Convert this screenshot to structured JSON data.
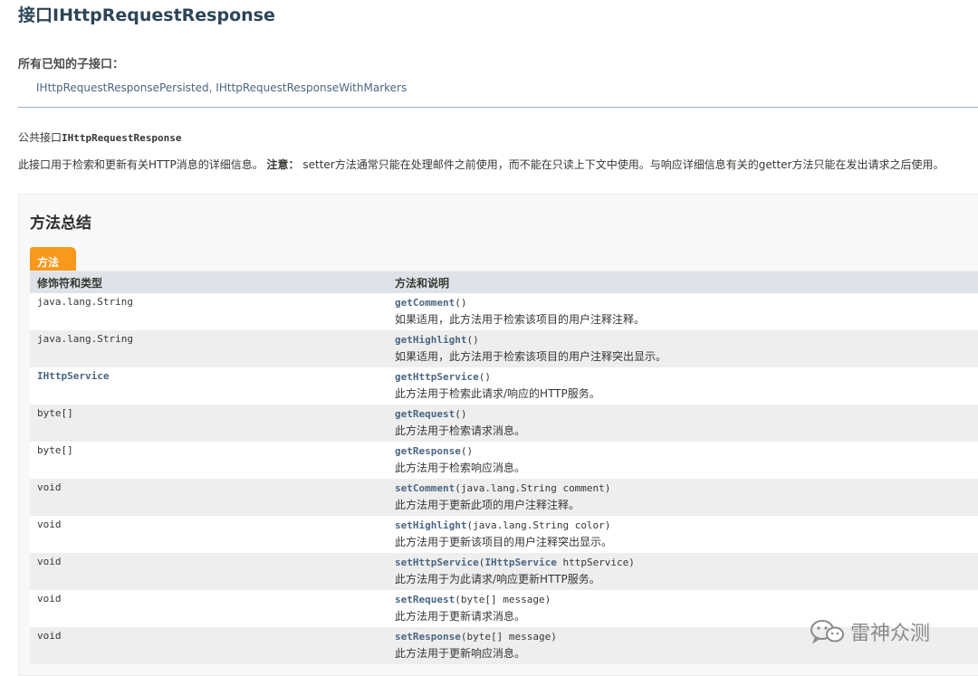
{
  "page": {
    "title": "接口IHttpRequestResponse",
    "known_subinterfaces_heading": "所有已知的子接口：",
    "subinterfaces": [
      "IHttpRequestResponsePersisted",
      "IHttpRequestResponseWithMarkers"
    ],
    "subinterface_separator": ", ",
    "declaration_prefix": "公共接口",
    "declaration_name": "IHttpRequestResponse",
    "description_main": "此接口用于检索和更新有关HTTP消息的详细信息。",
    "description_note_label": "注意：",
    "description_note": " setter方法通常只能在处理邮件之前使用，而不能在只读上下文中使用。与响应详细信息有关的getter方法只能在发出请求之后使用。"
  },
  "summary": {
    "heading": "方法总结",
    "tab_label": "方法",
    "col_type": "修饰符和类型",
    "col_method": "方法和说明",
    "rows": [
      {
        "type": "java.lang.String",
        "type_link": false,
        "method": "getComment",
        "params": "()",
        "desc": "如果适用，此方法用于检索该项目的用户注释注释。"
      },
      {
        "type": "java.lang.String",
        "type_link": false,
        "method": "getHighlight",
        "params": "()",
        "desc": "如果适用，此方法用于检索该项目的用户注释突出显示。"
      },
      {
        "type": "IHttpService",
        "type_link": true,
        "method": "getHttpService",
        "params": "()",
        "desc": "此方法用于检索此请求/响应的HTTP服务。"
      },
      {
        "type": "byte[]",
        "type_link": false,
        "method": "getRequest",
        "params": "()",
        "desc": "此方法用于检索请求消息。"
      },
      {
        "type": "byte[]",
        "type_link": false,
        "method": "getResponse",
        "params": "()",
        "desc": "此方法用于检索响应消息。"
      },
      {
        "type": "void",
        "type_link": false,
        "method": "setComment",
        "params": "(java.lang.String comment)",
        "desc": "此方法用于更新此项的用户注释注释。"
      },
      {
        "type": "void",
        "type_link": false,
        "method": "setHighlight",
        "params": "(java.lang.String color)",
        "desc": "此方法用于更新该项目的用户注释突出显示。"
      },
      {
        "type": "void",
        "type_link": false,
        "method": "setHttpService",
        "params_pre": "(",
        "params_link": "IHttpService",
        "params_post": " httpService)",
        "desc": "此方法用于为此请求/响应更新HTTP服务。"
      },
      {
        "type": "void",
        "type_link": false,
        "method": "setRequest",
        "params": "(byte[] message)",
        "desc": "此方法用于更新请求消息。"
      },
      {
        "type": "void",
        "type_link": false,
        "method": "setResponse",
        "params": "(byte[] message)",
        "desc": "此方法用于更新响应消息。"
      }
    ]
  },
  "watermark": {
    "text": "雷神众测",
    "icon": "wechat-icon",
    "color": "#8a8a8a"
  },
  "colors": {
    "link": "#4a6782",
    "tab": "#f8981d",
    "header_row": "#dee3e9",
    "alt_row": "#eeeeef",
    "title": "#2c4557"
  }
}
